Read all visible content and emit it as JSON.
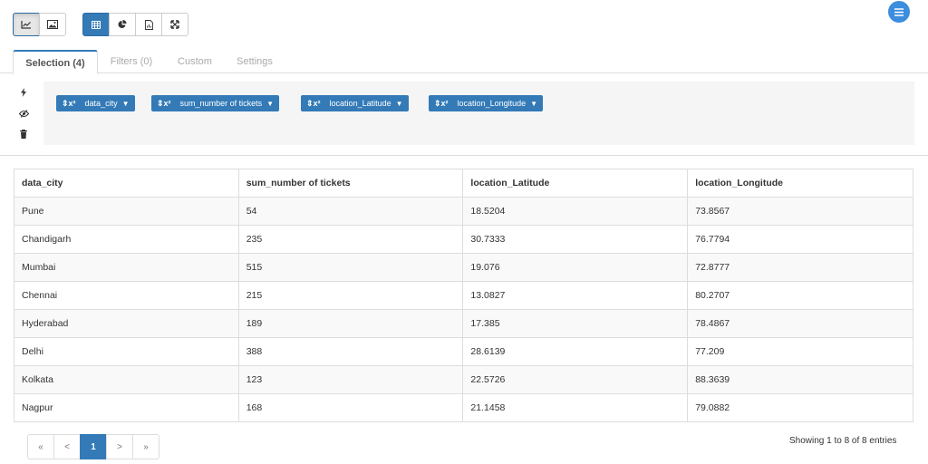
{
  "toolbar": {
    "group1": [
      {
        "icon": "line-chart-icon"
      },
      {
        "icon": "image-icon"
      }
    ],
    "group2": [
      {
        "icon": "table-icon"
      },
      {
        "icon": "pie-chart-icon"
      },
      {
        "icon": "file-chart-icon"
      },
      {
        "icon": "expand-icon"
      }
    ],
    "menu_icon": "hamburger-menu-icon",
    "accent_color": "#337ab7"
  },
  "tabs": [
    {
      "label": "Selection (4)",
      "active": true
    },
    {
      "label": "Filters (0)",
      "active": false
    },
    {
      "label": "Custom",
      "active": false
    },
    {
      "label": "Settings",
      "active": false
    }
  ],
  "side_actions": [
    "bolt-icon",
    "eye-slash-icon",
    "trash-icon"
  ],
  "selection": {
    "pill_symbol": "⇕x²",
    "fields": [
      "data_city",
      "sum_number of tickets",
      "location_Latitude",
      "location_Longitude"
    ]
  },
  "table": {
    "columns": [
      "data_city",
      "sum_number of tickets",
      "location_Latitude",
      "location_Longitude"
    ],
    "rows": [
      [
        "Pune",
        "54",
        "18.5204",
        "73.8567"
      ],
      [
        "Chandigarh",
        "235",
        "30.7333",
        "76.7794"
      ],
      [
        "Mumbai",
        "515",
        "19.076",
        "72.8777"
      ],
      [
        "Chennai",
        "215",
        "13.0827",
        "80.2707"
      ],
      [
        "Hyderabad",
        "189",
        "17.385",
        "78.4867"
      ],
      [
        "Delhi",
        "388",
        "28.6139",
        "77.209"
      ],
      [
        "Kolkata",
        "123",
        "22.5726",
        "88.3639"
      ],
      [
        "Nagpur",
        "168",
        "21.1458",
        "79.0882"
      ]
    ]
  },
  "pagination": {
    "first": "«",
    "prev": "<",
    "current": "1",
    "next": ">",
    "last": "»",
    "info": "Showing 1 to 8 of 8 entries"
  }
}
